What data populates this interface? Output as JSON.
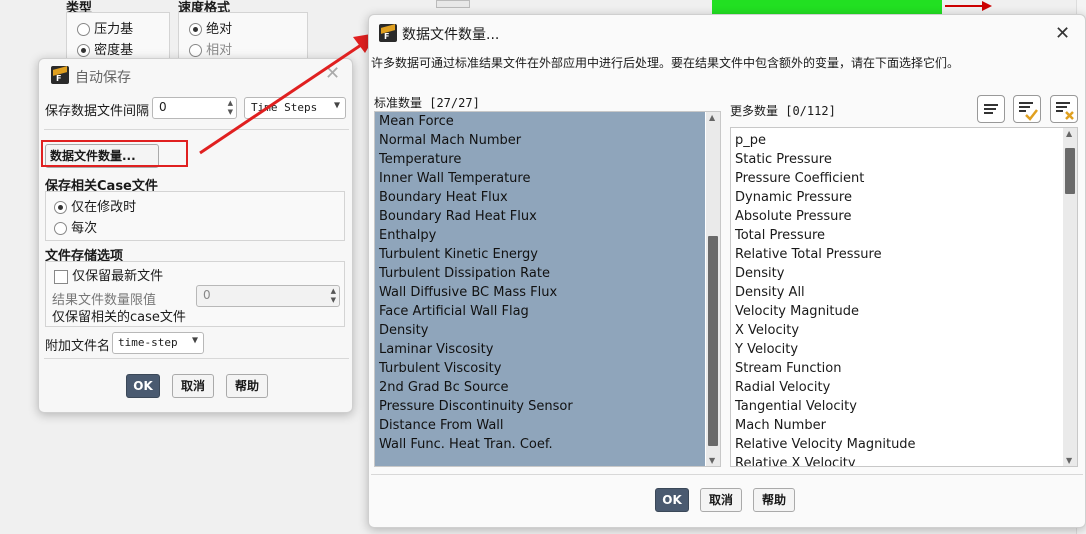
{
  "background": {
    "type_label": "类型",
    "type_options": [
      "压力基",
      "密度基"
    ],
    "speed_label": "速度格式",
    "speed_options": [
      "绝对",
      "相对"
    ]
  },
  "autosave": {
    "title": "自动保存",
    "interval_label": "保存数据文件间隔",
    "interval_value": "0",
    "interval_unit": "Time Steps",
    "data_file_button": "数据文件数量...",
    "case_section": "保存相关Case文件",
    "case_opt1": "仅在修改时",
    "case_opt2": "每次",
    "storage_section": "文件存储选项",
    "keep_latest": "仅保留最新文件",
    "max_files_label": "结果文件数量限值",
    "max_files_value": "0",
    "keep_case": "仅保留相关的case文件",
    "append_label": "附加文件名",
    "append_value": "time-step",
    "ok": "OK",
    "cancel": "取消",
    "help": "帮助"
  },
  "quantities": {
    "title": "数据文件数量...",
    "description": "许多数据可通过标准结果文件在外部应用中进行后处理。要在结果文件中包含额外的变量，请在下面选择它们。",
    "standard_label": "标准数量 [27/27]",
    "additional_label": "更多数量 [0/112]",
    "standard_items": [
      "Mean Force",
      "Normal Mach Number",
      "Temperature",
      "Inner Wall Temperature",
      "Boundary Heat Flux",
      "Boundary Rad Heat Flux",
      "Enthalpy",
      "Turbulent Kinetic Energy",
      "Turbulent Dissipation Rate",
      "Wall Diffusive BC Mass Flux",
      "Face Artificial Wall Flag",
      "Density",
      "Laminar Viscosity",
      "Turbulent Viscosity",
      "2nd Grad Bc Source",
      "Pressure Discontinuity Sensor",
      "Distance From Wall",
      "Wall Func. Heat Tran. Coef."
    ],
    "additional_items": [
      "p_pe",
      "Static Pressure",
      "Pressure Coefficient",
      "Dynamic Pressure",
      "Absolute Pressure",
      "Total Pressure",
      "Relative Total Pressure",
      "Density",
      "Density All",
      "Velocity Magnitude",
      "X Velocity",
      "Y Velocity",
      "Stream Function",
      "Radial Velocity",
      "Tangential Velocity",
      "Mach Number",
      "Relative Velocity Magnitude",
      "Relative X Velocity"
    ],
    "ok": "OK",
    "cancel": "取消",
    "help": "帮助"
  }
}
